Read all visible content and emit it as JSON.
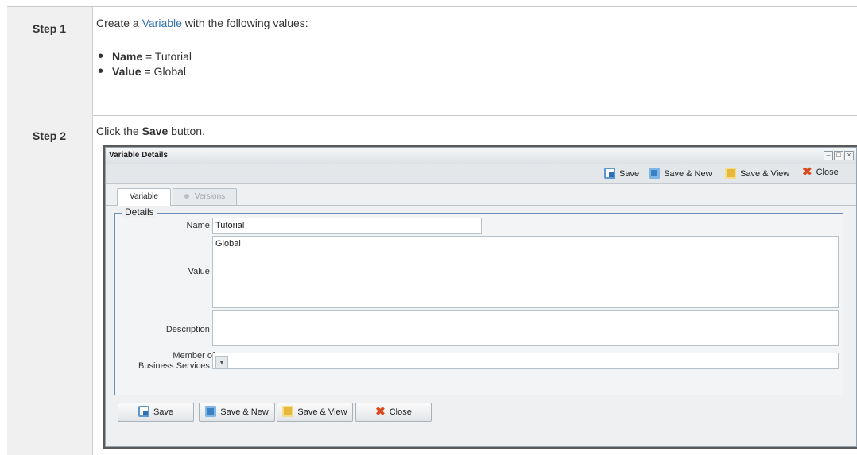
{
  "steps": [
    {
      "label": "Step 1",
      "intro_prefix": "Create a ",
      "intro_link": "Variable",
      "intro_suffix": " with the following values:",
      "bullets": [
        {
          "key": "Name",
          "value": " = Tutorial"
        },
        {
          "key": "Value",
          "value": " = Global"
        }
      ]
    },
    {
      "label": "Step 2",
      "text_prefix": "Click the ",
      "text_bold": "Save",
      "text_suffix": " button."
    }
  ],
  "window": {
    "title": "Variable Details",
    "controls": [
      "–",
      "□",
      "×"
    ],
    "toolbar": {
      "save": "Save",
      "save_new": "Save & New",
      "save_view": "Save & View",
      "close": "Close"
    },
    "tabs": [
      {
        "label": "Variable",
        "active": true
      },
      {
        "label": "Versions",
        "active": false
      }
    ],
    "details_legend": "Details",
    "fields": {
      "name_label": "Name :",
      "name_value": "Tutorial",
      "value_label": "Value :",
      "value_value": "Global",
      "description_label": "Description :",
      "description_value": "",
      "member_label_line1": "Member of",
      "member_label_line2": "Business Services :",
      "member_value": ""
    },
    "buttons": {
      "save": "Save",
      "save_new": "Save & New",
      "save_view": "Save & View",
      "close": "Close"
    }
  },
  "colors": {
    "link": "#3572b0",
    "step_header_bg": "#f0f0f0",
    "fieldset_border": "#6b8fb5",
    "close_icon": "#d94a1e"
  }
}
